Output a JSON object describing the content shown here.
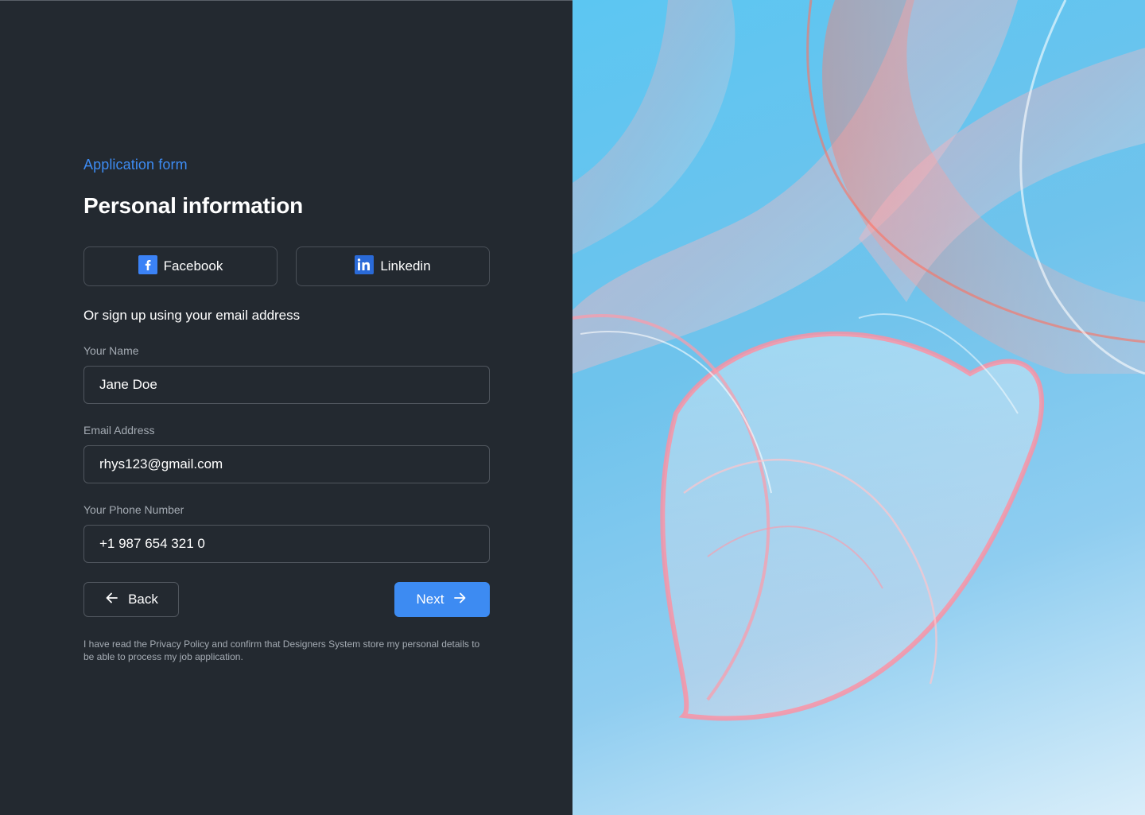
{
  "form": {
    "eyebrow": "Application form",
    "title": "Personal information",
    "social": {
      "facebook_label": "Facebook",
      "linkedin_label": "Linkedin"
    },
    "or_text": "Or sign up using your email address",
    "fields": {
      "name": {
        "label": "Your Name",
        "value": "Jane Doe"
      },
      "email": {
        "label": "Email Address",
        "value": "rhys123@gmail.com"
      },
      "phone": {
        "label": "Your Phone Number",
        "value": "+1 987 654 321 0"
      }
    },
    "buttons": {
      "back_label": "Back",
      "next_label": "Next"
    },
    "disclaimer": "I have read the Privacy Policy and confirm that Designers System store my personal details to be able to process my job application."
  },
  "icons": {
    "facebook": "facebook-icon",
    "linkedin": "linkedin-icon",
    "back": "arrow-left-icon",
    "next": "arrow-right-icon"
  },
  "colors": {
    "background": "#232930",
    "accent": "#3d8bf2",
    "border": "#50565e",
    "muted_text": "#a4abb3"
  }
}
